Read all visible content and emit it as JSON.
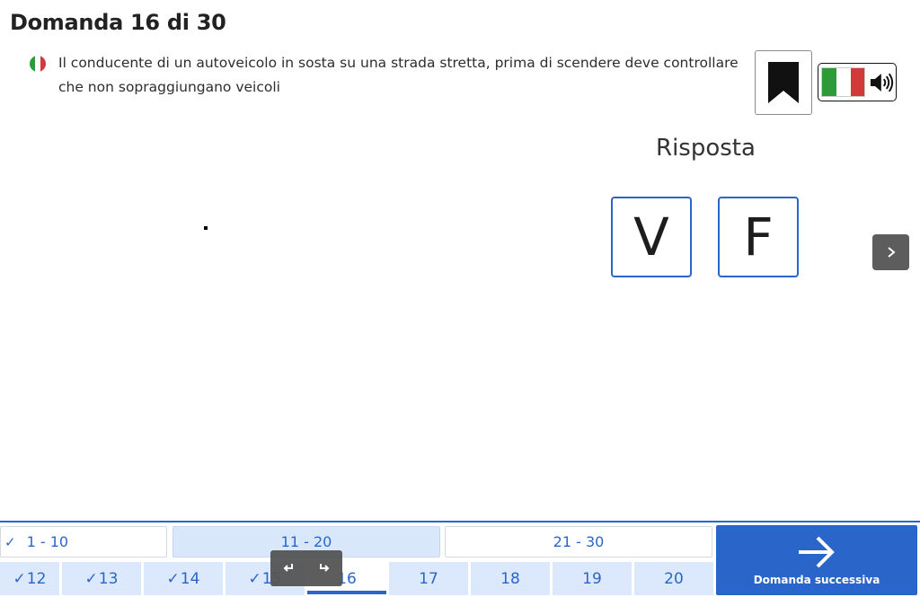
{
  "question": {
    "title": "Domanda 16 di 30",
    "text": "Il conducente di un autoveicolo in sosta su una strada stretta, prima di scendere deve controllare che non sopraggiungano veicoli"
  },
  "answer": {
    "label": "Risposta",
    "true_label": "V",
    "false_label": "F"
  },
  "nav": {
    "ranges": [
      "1 - 10",
      "11 - 20",
      "21 - 30"
    ],
    "active_range": "11 - 20",
    "numbers": [
      "12",
      "13",
      "14",
      "15",
      "16",
      "17",
      "18",
      "19",
      "20"
    ],
    "checks": [
      "✓",
      "✓",
      "✓",
      "✓"
    ],
    "current": "16",
    "next_label": "Domanda successiva"
  },
  "icons": {
    "flag": "italian-flag-icon",
    "bookmark": "bookmark-icon",
    "speaker": "speaker-icon",
    "chevron": "chevron-right-icon",
    "undo": "undo-icon",
    "redo": "redo-icon",
    "arrow": "arrow-right-icon"
  },
  "colors": {
    "accent": "#2a66c9",
    "flag_green": "#2d9b3a",
    "flag_red": "#d23a3a"
  }
}
